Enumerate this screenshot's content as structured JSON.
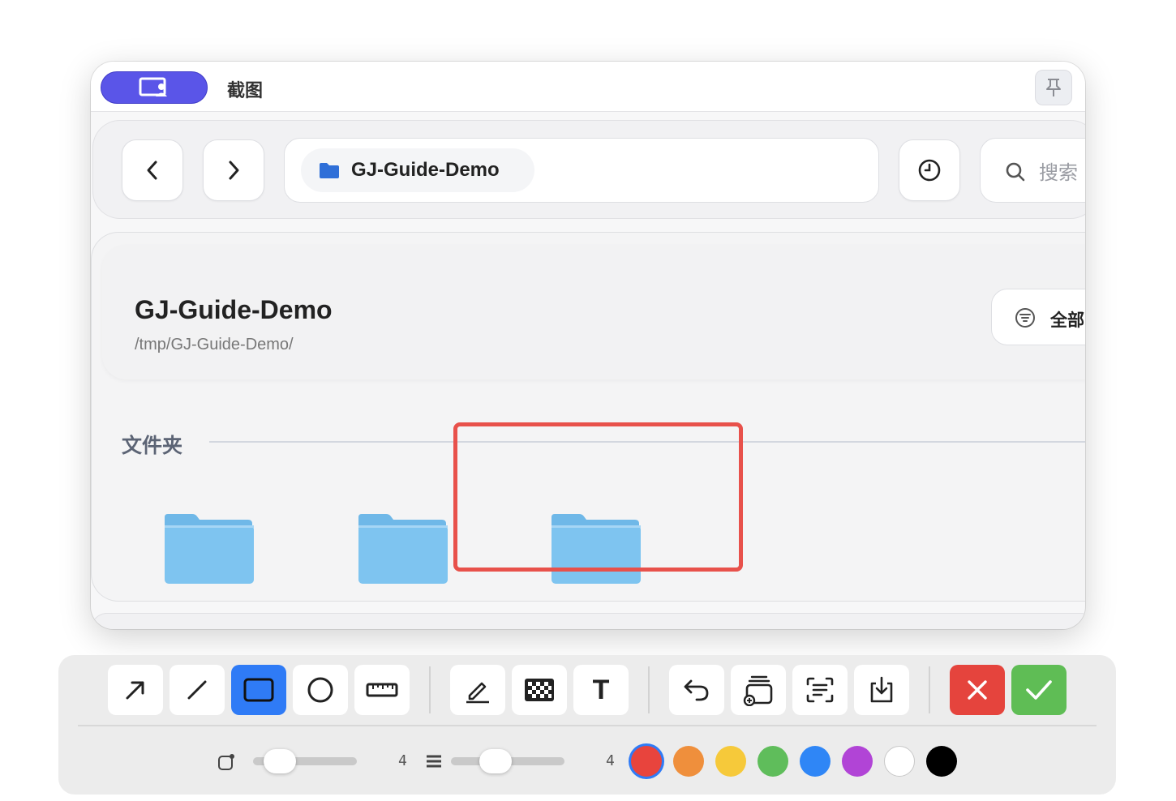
{
  "window": {
    "title": "截图",
    "app_icon": "screen-user-icon",
    "pin_icon": "pin-icon"
  },
  "nav": {
    "back_icon": "chevron-left-icon",
    "forward_icon": "chevron-right-icon",
    "path_folder_icon": "folder-icon",
    "current_folder": "GJ-Guide-Demo",
    "history_icon": "clock-icon",
    "search_placeholder": "搜索",
    "search_icon": "search-icon"
  },
  "header": {
    "title": "GJ-Guide-Demo",
    "path": "/tmp/GJ-Guide-Demo/",
    "filter_label": "全部",
    "filter_icon": "filter-icon"
  },
  "section": {
    "title": "文件夹",
    "folders": [
      {
        "icon": "folder-icon"
      },
      {
        "icon": "folder-icon"
      },
      {
        "icon": "folder-icon"
      }
    ]
  },
  "annotation": {
    "shape": "rectangle",
    "color": "#e8514b"
  },
  "toolbar": {
    "tools": [
      {
        "name": "arrow-tool",
        "icon": "arrow-icon",
        "active": false
      },
      {
        "name": "line-tool",
        "icon": "line-icon",
        "active": false
      },
      {
        "name": "rectangle-tool",
        "icon": "rectangle-icon",
        "active": true
      },
      {
        "name": "ellipse-tool",
        "icon": "circle-icon",
        "active": false
      },
      {
        "name": "ruler-tool",
        "icon": "ruler-icon",
        "active": false
      },
      {
        "name": "pen-tool",
        "icon": "pen-icon",
        "active": false
      },
      {
        "name": "mosaic-tool",
        "icon": "mosaic-icon",
        "active": false
      },
      {
        "name": "text-tool",
        "icon": "text-icon",
        "label": "T",
        "active": false
      },
      {
        "name": "undo-tool",
        "icon": "undo-icon"
      },
      {
        "name": "add-pin-tool",
        "icon": "add-window-icon"
      },
      {
        "name": "ocr-tool",
        "icon": "scan-text-icon"
      },
      {
        "name": "save-tool",
        "icon": "download-icon"
      },
      {
        "name": "cancel-tool",
        "icon": "close-icon"
      },
      {
        "name": "confirm-tool",
        "icon": "check-icon"
      }
    ],
    "radius_value": 0.15,
    "stroke_width": "4",
    "stroke_width_fraction": 0.35,
    "font_size": "4",
    "colors": [
      "#e8443d",
      "#ef8f3c",
      "#f6c93a",
      "#5fbd5b",
      "#2f86f6",
      "#b144d6",
      "#ffffff",
      "#000000"
    ],
    "selected_color": "#e8443d",
    "accent": "#2f7bf6"
  }
}
